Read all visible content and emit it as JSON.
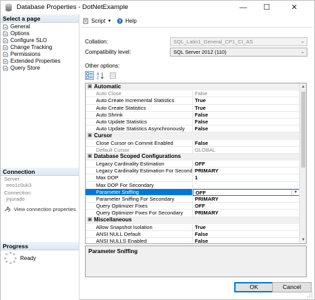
{
  "window": {
    "title": "Database Properties - DotNetExample",
    "minimize_glyph": "—",
    "maximize_glyph": "☐",
    "close_glyph": "✕"
  },
  "left_pane": {
    "select_page_header": "Select a page",
    "pages": [
      {
        "label": "General",
        "icon": "page-icon"
      },
      {
        "label": "Options",
        "icon": "page-icon"
      },
      {
        "label": "Configure SLO",
        "icon": "page-icon"
      },
      {
        "label": "Change Tracking",
        "icon": "page-icon"
      },
      {
        "label": "Permissions",
        "icon": "page-icon"
      },
      {
        "label": "Extended Properties",
        "icon": "page-icon"
      },
      {
        "label": "Query Store",
        "icon": "page-icon"
      }
    ],
    "connection_header": "Connection",
    "server_label": "Server:",
    "server_value": "eeo1c0uk3",
    "connection_label": "Connection:",
    "connection_value": "jnjurado",
    "view_connection_link": "View connection properties",
    "progress_header": "Progress",
    "progress_status": "Ready"
  },
  "toolbar": {
    "script_label": "Script",
    "help_label": "Help"
  },
  "form": {
    "collation_label": "Collation:",
    "collation_value": "SQL_Latin1_General_CP1_CI_AS",
    "compat_label": "Compatibility level:",
    "compat_value": "SQL Server 2012 (110)",
    "other_options_label": "Other options:"
  },
  "property_grid": {
    "categories": [
      {
        "name": "Automatic",
        "expanded_glyph": "▣",
        "rows": [
          {
            "name": "Auto Close",
            "value": "False",
            "disabled": true
          },
          {
            "name": "Auto Create Incremental Statistics",
            "value": "True",
            "disabled": false
          },
          {
            "name": "Auto Create Statistics",
            "value": "True",
            "disabled": false
          },
          {
            "name": "Auto Shrink",
            "value": "False",
            "disabled": false
          },
          {
            "name": "Auto Update Statistics",
            "value": "False",
            "disabled": false
          },
          {
            "name": "Auto Update Statistics Asynchronously",
            "value": "False",
            "disabled": false
          }
        ]
      },
      {
        "name": "Cursor",
        "expanded_glyph": "▣",
        "rows": [
          {
            "name": "Close Cursor on Commit Enabled",
            "value": "False",
            "disabled": false
          },
          {
            "name": "Default Cursor",
            "value": "GLOBAL",
            "disabled": true
          }
        ]
      },
      {
        "name": "Database Scoped Configurations",
        "expanded_glyph": "▣",
        "rows": [
          {
            "name": "Legacy Cardinality Estimation",
            "value": "OFF",
            "disabled": false
          },
          {
            "name": "Legacy Cardinality Estimation For Secondary",
            "value": "PRIMARY",
            "disabled": false
          },
          {
            "name": "Max DOP",
            "value": "1",
            "disabled": false
          },
          {
            "name": "Max DOP For Secondary",
            "value": "",
            "disabled": false
          },
          {
            "name": "Parameter Sniffing",
            "value": "OFF",
            "disabled": false,
            "selected": true
          },
          {
            "name": "Parameter Sniffing For Secondary",
            "value": "PRIMARY",
            "disabled": false
          },
          {
            "name": "Query Optimizer Fixes",
            "value": "OFF",
            "disabled": false
          },
          {
            "name": "Query Optimizer Fixes For Secondary",
            "value": "PRIMARY",
            "disabled": false
          }
        ]
      },
      {
        "name": "Miscellaneous",
        "expanded_glyph": "▣",
        "rows": [
          {
            "name": "Allow Snapshot Isolation",
            "value": "True",
            "disabled": false
          },
          {
            "name": "ANSI NULL Default",
            "value": "False",
            "disabled": false
          },
          {
            "name": "ANSI NULLS Enabled",
            "value": "False",
            "disabled": false
          }
        ]
      }
    ]
  },
  "description": {
    "title": "Parameter Sniffing"
  },
  "buttons": {
    "ok_label": "OK",
    "cancel_label": "Cancel"
  },
  "colors": {
    "selection": "#0078d7",
    "category_bg": "#f0f0f0",
    "disabled_text": "#808080"
  }
}
